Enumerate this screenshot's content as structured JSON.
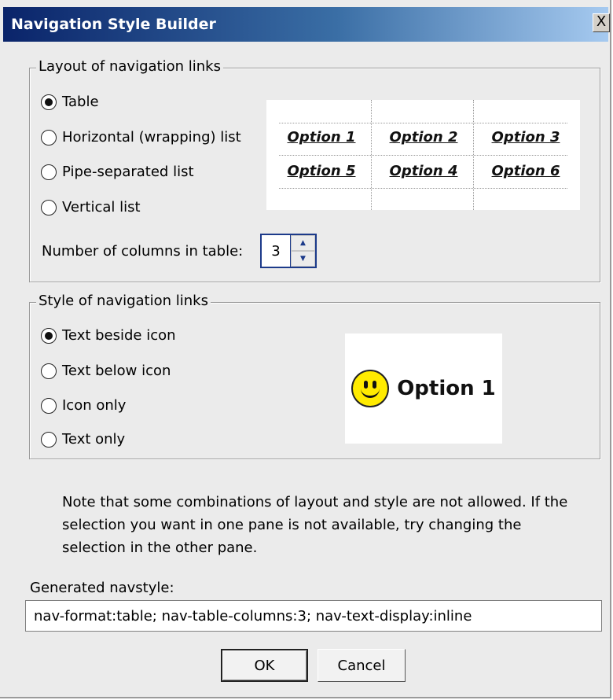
{
  "window": {
    "title": "Navigation Style Builder",
    "close_label": "X"
  },
  "layout_group": {
    "legend": "Layout of navigation links",
    "options": [
      "Table",
      "Horizontal (wrapping) list",
      "Pipe-separated list",
      "Vertical list"
    ],
    "selected": "Table",
    "preview_cells": [
      "Option 1",
      "Option 2",
      "Option 3",
      "Option 5",
      "Option 4",
      "Option 6"
    ],
    "columns_label": "Number of columns in table:",
    "columns_value": "3"
  },
  "style_group": {
    "legend": "Style of navigation links",
    "options": [
      "Text beside icon",
      "Text below icon",
      "Icon only",
      "Text only"
    ],
    "selected": "Text beside icon",
    "preview_label": "Option 1",
    "preview_icon": "smiley-icon"
  },
  "note": "Note that some combinations of layout and style are not allowed. If the selection you want in one pane is not available, try changing the selection in the other pane.",
  "generated": {
    "label": "Generated navstyle:",
    "value": "nav-format:table; nav-table-columns:3; nav-text-display:inline"
  },
  "buttons": {
    "ok": "OK",
    "cancel": "Cancel"
  },
  "colors": {
    "titlebar_start": "#0a246a",
    "titlebar_end": "#a6caf0",
    "dialog_bg": "#ebebeb"
  }
}
